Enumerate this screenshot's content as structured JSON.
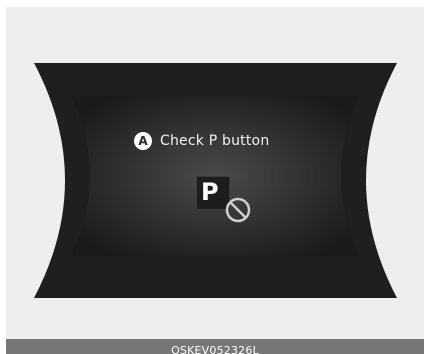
{
  "display": {
    "label_badge": "A",
    "message": "Check P button",
    "p_symbol": "P",
    "prohibited_icon": "prohibited-circle-icon"
  },
  "caption": {
    "code": "OSKEV052326L"
  },
  "colors": {
    "panel_background": "#eeeeee",
    "display_dark": "#1f1f1f",
    "display_center": "#444444",
    "caption_bar": "#777777",
    "text": "#f2f2f2"
  }
}
